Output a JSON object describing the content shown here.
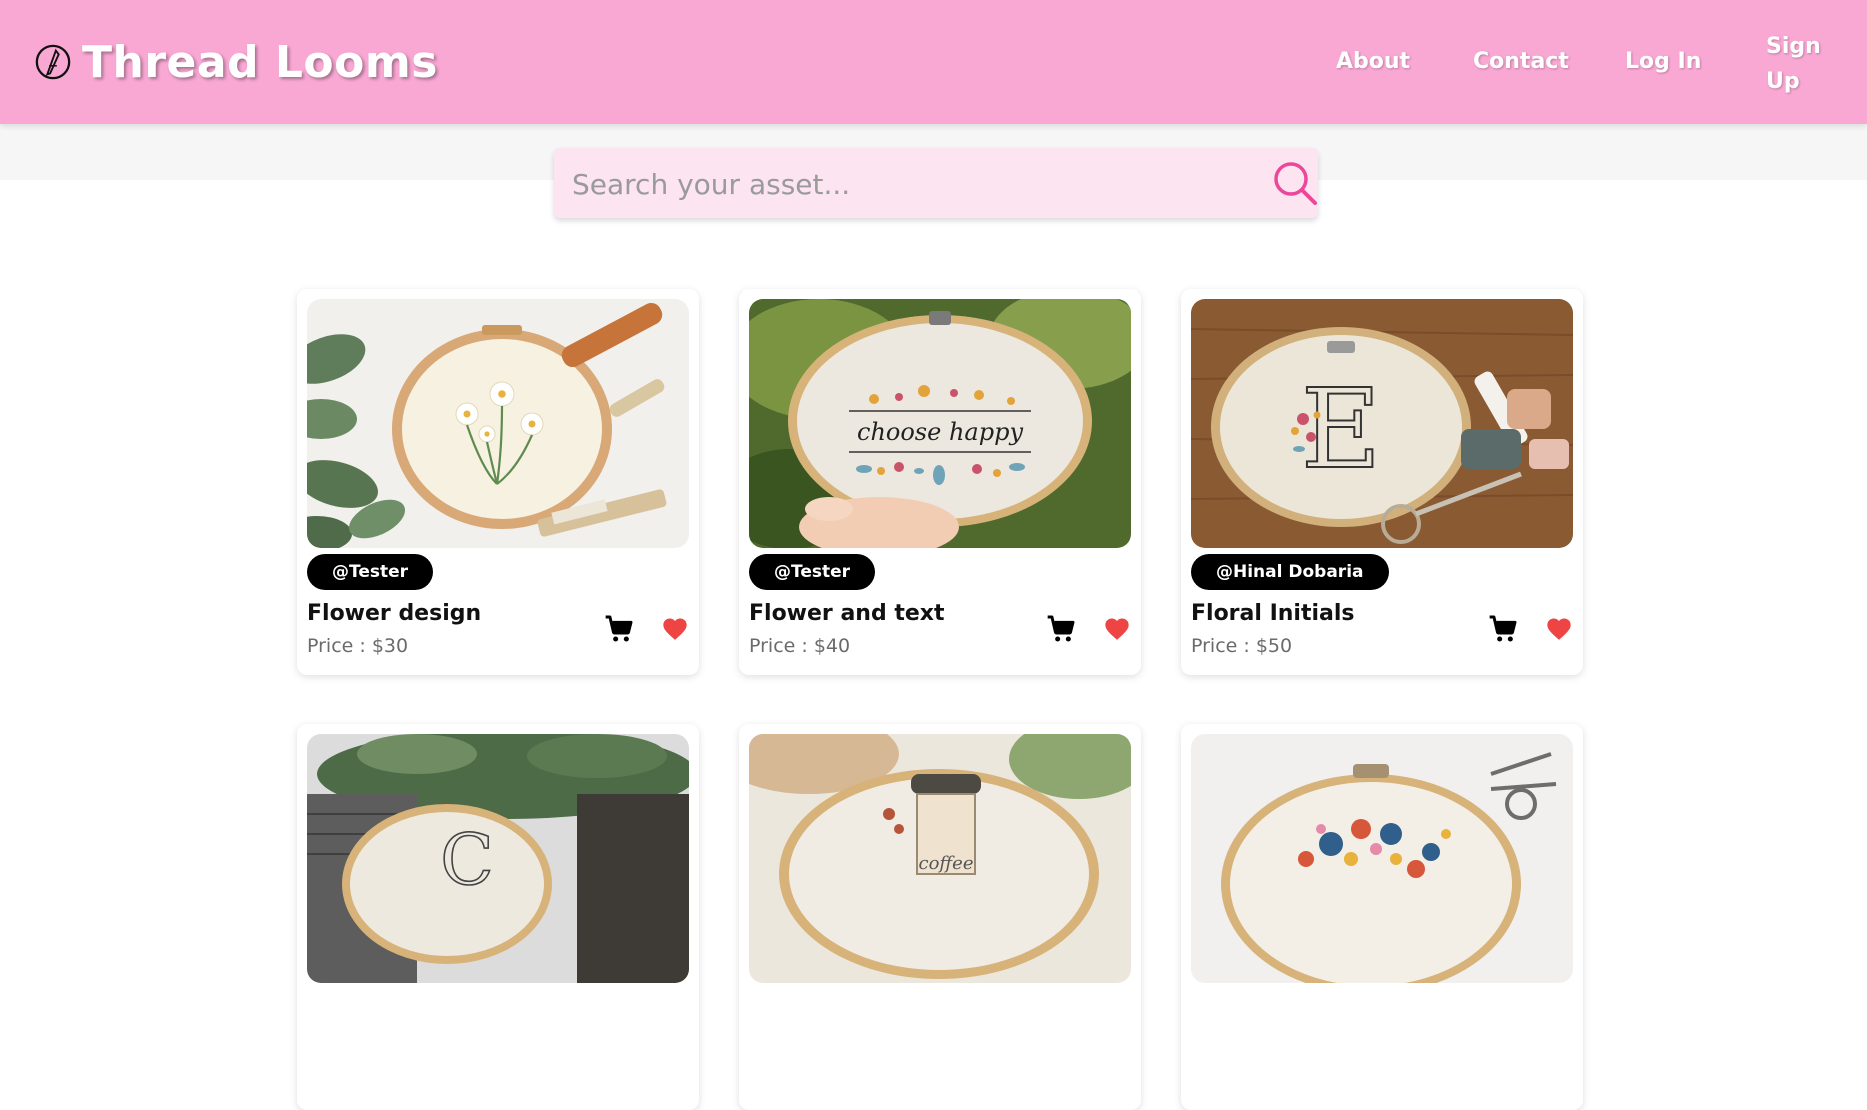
{
  "navbar": {
    "brand": "Thread Looms",
    "logo_icon": "feather-pen-icon",
    "links": {
      "about": "About",
      "contact": "Contact",
      "login": "Log In",
      "signup": "Sign Up"
    },
    "background_color": "#f9a8d4"
  },
  "search": {
    "placeholder": "Search your asset...",
    "value": "",
    "icon": "search-icon",
    "accent_color": "#ec4899"
  },
  "products": [
    {
      "author": "@Tester",
      "title": "Flower design",
      "price": "Price : $30",
      "image": "daisy-embroidery-hoop"
    },
    {
      "author": "@Tester",
      "title": "Flower and text",
      "price": "Price : $40",
      "image": "choose-happy-embroidery-hoop"
    },
    {
      "author": "@Hinal Dobaria",
      "title": "Floral Initials",
      "price": "Price : $50",
      "image": "letter-e-embroidery-hoop"
    },
    {
      "author": "",
      "title": "",
      "price": "",
      "image": "letter-c-embroidery-hoop"
    },
    {
      "author": "",
      "title": "",
      "price": "",
      "image": "coffee-cup-embroidery-hoop"
    },
    {
      "author": "",
      "title": "",
      "price": "",
      "image": "bouquet-embroidery-hoop"
    }
  ],
  "icons": {
    "cart": "cart-icon",
    "favorite": "heart-icon"
  },
  "colors": {
    "heart": "#ef4444",
    "badge": "#000000",
    "price_text": "#6b6b6b"
  }
}
